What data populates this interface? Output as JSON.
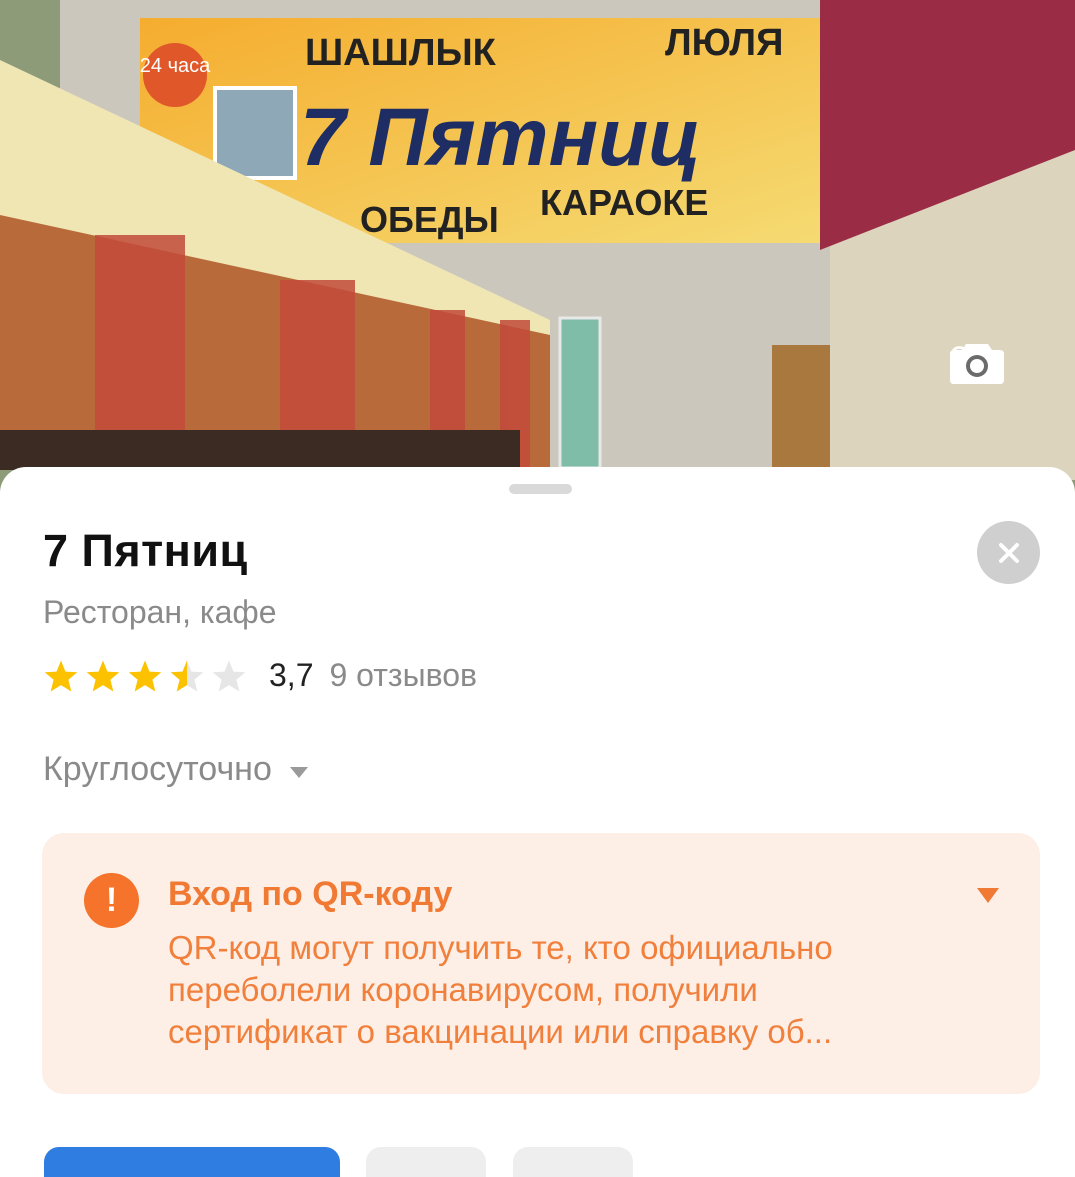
{
  "photo": {
    "sign_top_left": "ШАШЛЫК",
    "sign_top_right": "ЛЮЛЯ",
    "sign_badge": "24 часа",
    "sign_name": "7 Пятниц",
    "sign_bottom_left": "ОБЕДЫ",
    "sign_bottom_right": "КАРАОКЕ",
    "count": "3",
    "icon": "camera-icon"
  },
  "place": {
    "title": "7 Пятниц",
    "subtitle": "Ресторан, кафе",
    "rating_value": "3,7",
    "rating_stars": 3.5,
    "reviews": "9 отзывов",
    "hours": "Круглосуточно"
  },
  "notice": {
    "title": "Вход по QR-коду",
    "text": "QR-код могут получить те, кто официально переболели коронавирусом, получили сертификат о вакцинации или справку об...",
    "icon": "warning-icon"
  },
  "colors": {
    "accent_orange": "#f5732a",
    "star_yellow": "#fcc200",
    "button_blue": "#2f7de1"
  }
}
